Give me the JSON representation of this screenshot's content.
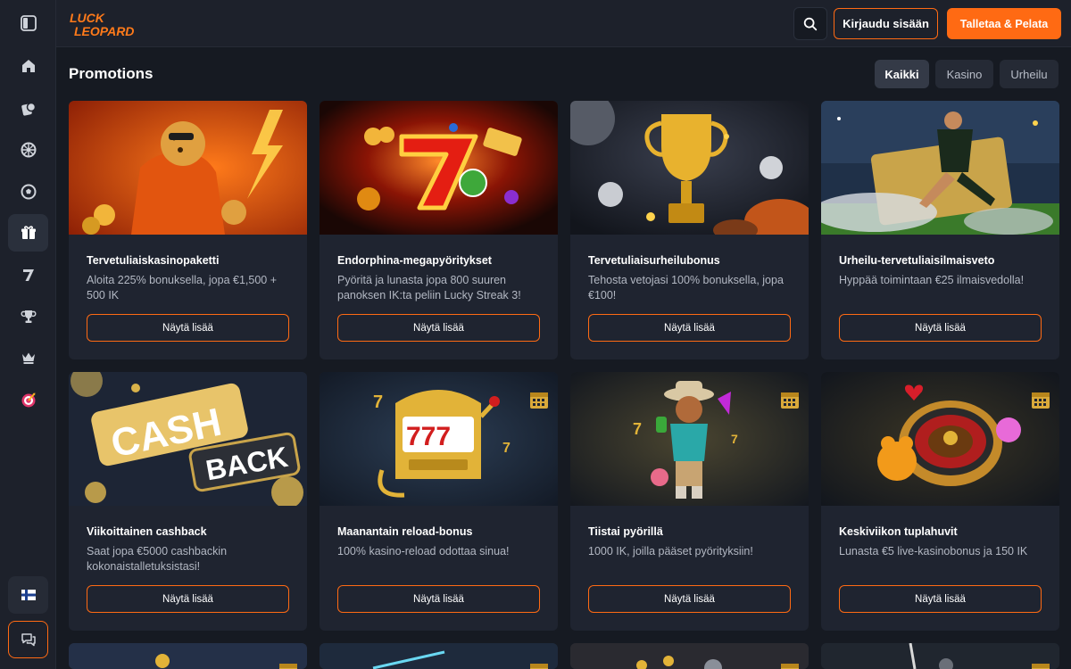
{
  "header": {
    "logo_text_line1": "LUCK",
    "logo_text_line2": "LEOPARD",
    "login_label": "Kirjaudu sisään",
    "deposit_label": "Talletaa & Pelata"
  },
  "page": {
    "title": "Promotions"
  },
  "filters": [
    {
      "label": "Kaikki",
      "active": true
    },
    {
      "label": "Kasino",
      "active": false
    },
    {
      "label": "Urheilu",
      "active": false
    }
  ],
  "sidebar": {
    "items": [
      {
        "icon": "panel-toggle-icon"
      },
      {
        "icon": "home-icon"
      },
      {
        "icon": "casino-chips-icon"
      },
      {
        "icon": "roulette-icon"
      },
      {
        "icon": "soccer-ball-icon"
      },
      {
        "icon": "gift-icon",
        "active": true
      },
      {
        "icon": "lucky-seven-icon"
      },
      {
        "icon": "trophy-icon"
      },
      {
        "icon": "crown-icon"
      },
      {
        "icon": "target-icon"
      }
    ],
    "language_icon": "finnish-flag-icon",
    "chat_icon": "chat-icon"
  },
  "promotions": [
    {
      "title": "Tervetuliaiskasinopaketti",
      "description": "Aloita 225% bonuksella, jopa €1,500 + 500 IK",
      "button": "Näytä lisää"
    },
    {
      "title": "Endorphina-megapyöritykset",
      "description": "Pyöritä ja lunasta jopa 800 suuren panoksen IK:ta peliin Lucky Streak 3!",
      "button": "Näytä lisää"
    },
    {
      "title": "Tervetuliaisurheilubonus",
      "description": "Tehosta vetojasi 100% bonuksella, jopa €100!",
      "button": "Näytä lisää"
    },
    {
      "title": "Urheilu-tervetuliaisilmaisveto",
      "description": "Hyppää toimintaan €25 ilmaisvedolla!",
      "button": "Näytä lisää"
    },
    {
      "title": "Viikoittainen cashback",
      "description": "Saat jopa €5000 cashbackin kokonaistalletuksistasi!",
      "button": "Näytä lisää",
      "banner_line1": "CASH",
      "banner_line2": "BACK"
    },
    {
      "title": "Maanantain reload-bonus",
      "description": "100% kasino-reload odottaa sinua!",
      "button": "Näytä lisää"
    },
    {
      "title": "Tiistai pyörillä",
      "description": "1000 IK, joilla pääset pyörityksiin!",
      "button": "Näytä lisää"
    },
    {
      "title": "Keskiviikon tuplahuvit",
      "description": "Lunasta €5 live-kasinobonus ja 150 IK",
      "button": "Näytä lisää"
    }
  ],
  "colors": {
    "accent": "#ff6a13",
    "background": "#161a22",
    "card": "#1f2430"
  }
}
